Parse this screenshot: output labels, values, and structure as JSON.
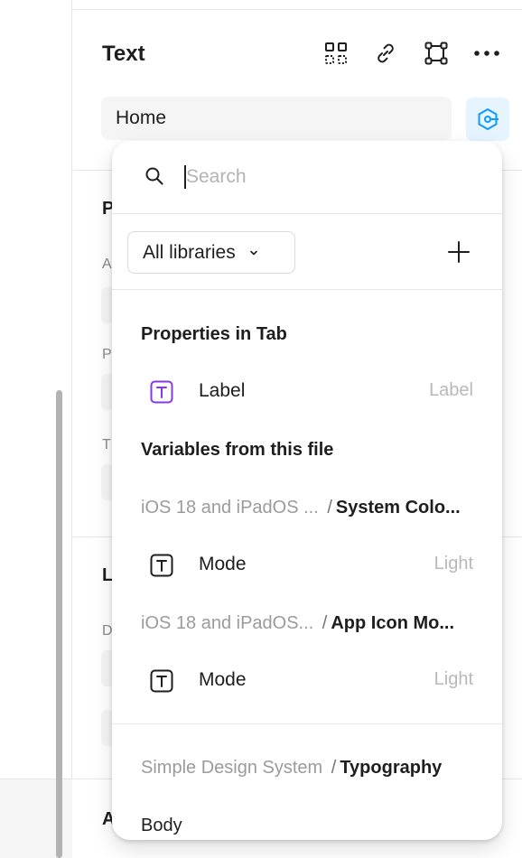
{
  "panel": {
    "title": "Text",
    "layer_name": "Home",
    "toolbar_icons": [
      "grid-select-icon",
      "link-icon",
      "frame-icon",
      "more-icon"
    ],
    "partial_sections": [
      {
        "heading": "P",
        "labels": [
          "A",
          "P",
          "T"
        ]
      },
      {
        "heading": "L",
        "labels": [
          "D"
        ]
      },
      {
        "heading": "A",
        "labels": []
      }
    ]
  },
  "dropdown": {
    "search": {
      "placeholder": "Search",
      "value": ""
    },
    "library_filter": {
      "selected": "All libraries"
    },
    "groups": [
      {
        "heading": "Properties in Tab",
        "items": [
          {
            "icon": "text-type-icon",
            "label": "Label",
            "value": "Label"
          }
        ]
      },
      {
        "heading": "Variables from this file",
        "subgroups": [
          {
            "path_muted": "iOS 18 and iPadOS ...",
            "separator": "/",
            "path_strong": "System Colo...",
            "items": [
              {
                "icon": "text-type-icon",
                "label": "Mode",
                "value": "Light"
              }
            ]
          },
          {
            "path_muted": "iOS 18 and iPadOS...",
            "separator": "/",
            "path_strong": "App Icon Mo...",
            "items": [
              {
                "icon": "text-type-icon",
                "label": "Mode",
                "value": "Light"
              }
            ]
          }
        ]
      },
      {
        "path_muted": "Simple Design System",
        "separator": "/",
        "path_strong": "Typography",
        "items": [
          {
            "label": "Body"
          }
        ]
      }
    ]
  },
  "colors": {
    "accent": "#0d99ff",
    "accent_bg": "#e5f4ff",
    "property_purple": "#8638e5",
    "muted_text": "#9b9b9b",
    "divider": "#e6e6e6"
  }
}
